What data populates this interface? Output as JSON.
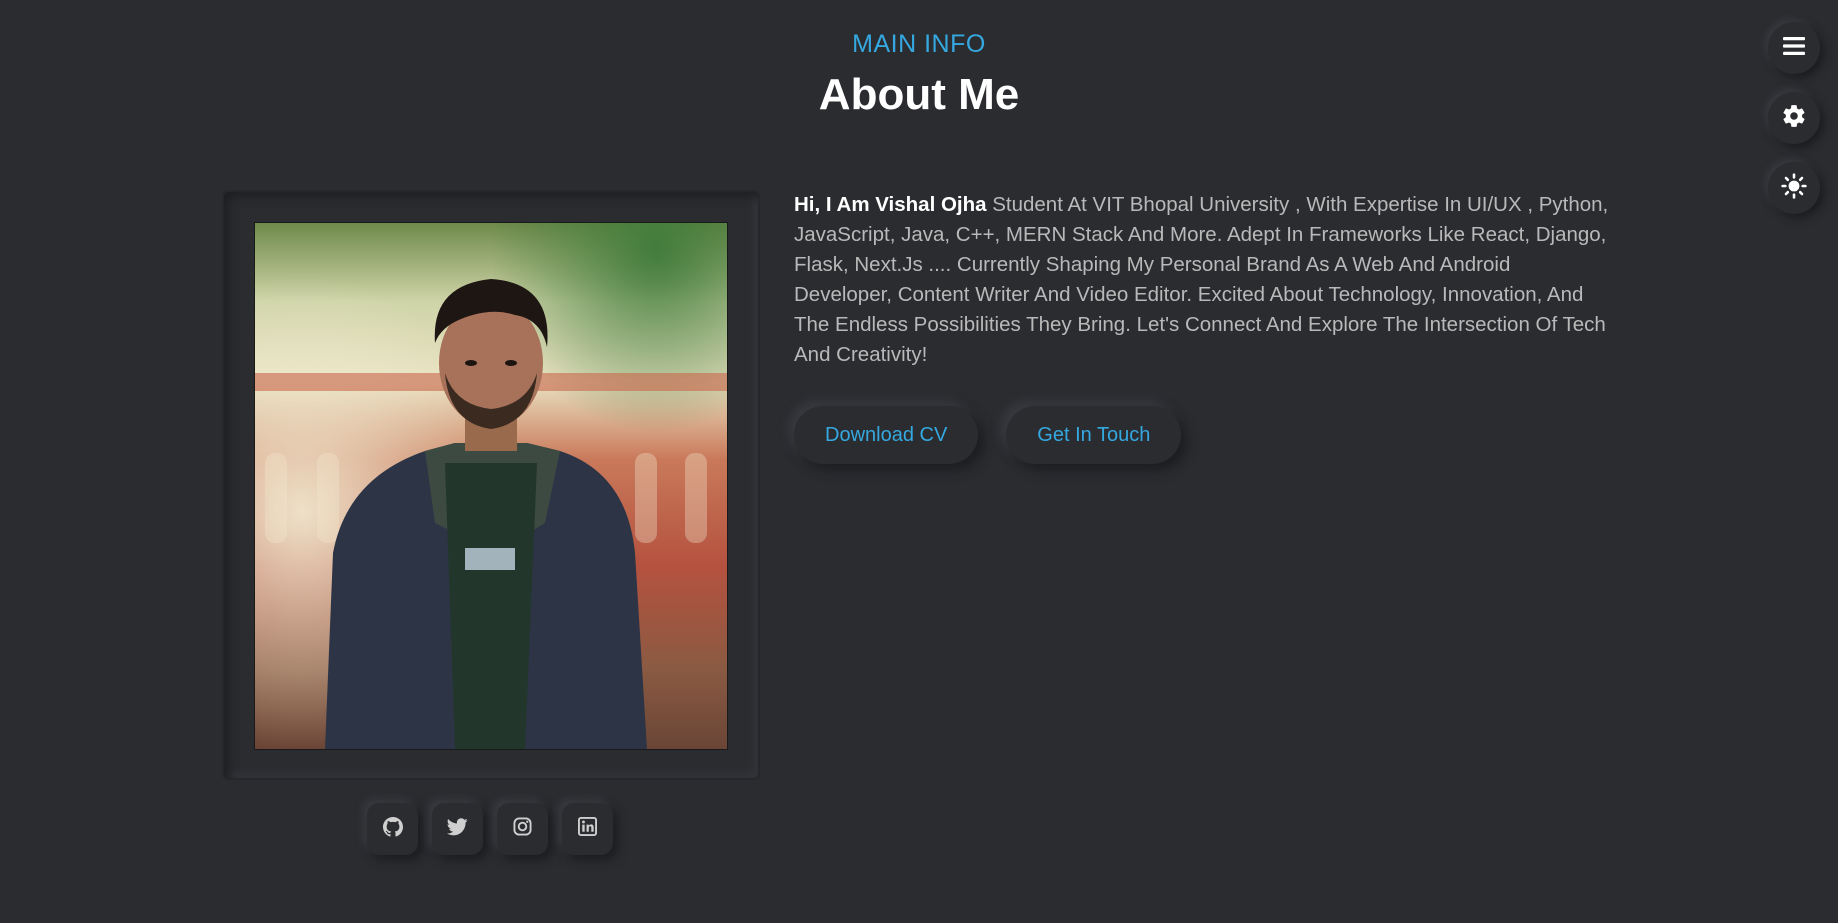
{
  "header": {
    "kicker": "MAIN INFO",
    "title": "About Me"
  },
  "profile": {
    "intro_name": "Hi, I Am Vishal Ojha",
    "intro_text": " Student At VIT Bhopal University , With Expertise In UI/UX , Python, JavaScript, Java, C++, MERN Stack And More. Adept In Frameworks Like React, Django, Flask, Next.Js .... Currently Shaping My Personal Brand As A Web And Android Developer, Content Writer And Video Editor. Excited About Technology, Innovation, And The Endless Possibilities They Bring. Let's Connect And Explore The Intersection Of Tech And Creativity!",
    "photo_icon": "profile-photo"
  },
  "actions": {
    "download_cv": "Download CV",
    "get_in_touch": "Get In Touch"
  },
  "socials": [
    {
      "icon": "github-icon"
    },
    {
      "icon": "twitter-icon"
    },
    {
      "icon": "instagram-icon"
    },
    {
      "icon": "linkedin-icon"
    }
  ],
  "side_controls": [
    {
      "icon": "menu-icon"
    },
    {
      "icon": "gear-icon"
    },
    {
      "icon": "sun-icon"
    }
  ],
  "colors": {
    "background": "#2b2c30",
    "accent": "#35a8e0",
    "heading": "#ffffff",
    "body_text": "#b9b9b9"
  }
}
